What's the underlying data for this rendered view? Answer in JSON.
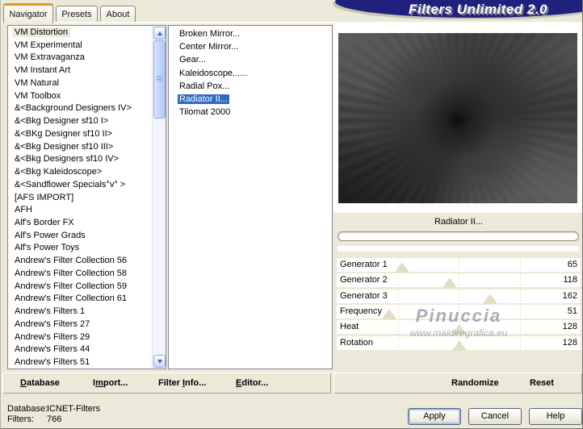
{
  "window": {
    "banner_title": "Filters Unlimited 2.0"
  },
  "tabs": [
    {
      "label": "Navigator",
      "active": true
    },
    {
      "label": "Presets",
      "active": false
    },
    {
      "label": "About",
      "active": false
    }
  ],
  "category_list": {
    "highlighted_index": 0,
    "items": [
      "VM Distortion",
      "VM Experimental",
      "VM Extravaganza",
      "VM Instant Art",
      "VM Natural",
      "VM Toolbox",
      "&<Background Designers IV>",
      "&<Bkg Designer sf10 I>",
      "&<BKg Designer sf10 II>",
      "&<Bkg Designer sf10 III>",
      "&<Bkg Designers sf10 IV>",
      "&<Bkg Kaleidoscope>",
      "&<Sandflower Specials°v° >",
      "[AFS IMPORT]",
      "AFH",
      "Alf's Border FX",
      "Alf's Power Grads",
      "Alf's Power Toys",
      "Andrew's Filter Collection 56",
      "Andrew's Filter Collection 58",
      "Andrew's Filter Collection 59",
      "Andrew's Filter Collection 61",
      "Andrew's Filters 1",
      "Andrew's Filters 27",
      "Andrew's Filters 29",
      "Andrew's Filters 44",
      "Andrew's Filters 51"
    ]
  },
  "filter_list": {
    "selected_index": 5,
    "items": [
      "Broken Mirror...",
      "Center Mirror...",
      "Gear...",
      "Kaleidoscope......",
      "Radial Pox...",
      "Radiator II...",
      "Tilomat 2000"
    ]
  },
  "preview": {
    "filter_title": "Radiator II..."
  },
  "sliders": {
    "max": 255,
    "items": [
      {
        "label": "Generator 1",
        "value": 65
      },
      {
        "label": "Generator 2",
        "value": 118
      },
      {
        "label": "Generator 3",
        "value": 162
      },
      {
        "label": "Frequency",
        "value": 51
      },
      {
        "label": "Heat",
        "value": 128
      },
      {
        "label": "Rotation",
        "value": 128
      }
    ]
  },
  "watermark": {
    "line1": "Pinuccia",
    "line2": "www.maidiregrafica.eu"
  },
  "toolbar": {
    "left": [
      {
        "label": "Database",
        "underline_index": 0
      },
      {
        "label": "Import...",
        "underline_index": 1
      },
      {
        "label": "Filter Info...",
        "underline_index": 7
      },
      {
        "label": "Editor...",
        "underline_index": 0
      }
    ],
    "right": [
      {
        "label": "Randomize",
        "underline_index": -1
      },
      {
        "label": "Reset",
        "underline_index": -1
      }
    ]
  },
  "status": {
    "database_label": "Database:",
    "database_value": "ICNET-Filters",
    "filters_label": "Filters:",
    "filters_value": "766"
  },
  "action_buttons": [
    {
      "label": "Apply",
      "default": true
    },
    {
      "label": "Cancel",
      "default": false
    },
    {
      "label": "Help",
      "default": false
    }
  ],
  "colors": {
    "dialog_beige": "#ECE9D8",
    "selection_blue": "#316AC5",
    "banner_navy": "#20207E",
    "tab_accent_orange": "#E3962B",
    "highlight_cream": "#EDEADC",
    "slider_thumb_tan": "#E2DEC6"
  }
}
